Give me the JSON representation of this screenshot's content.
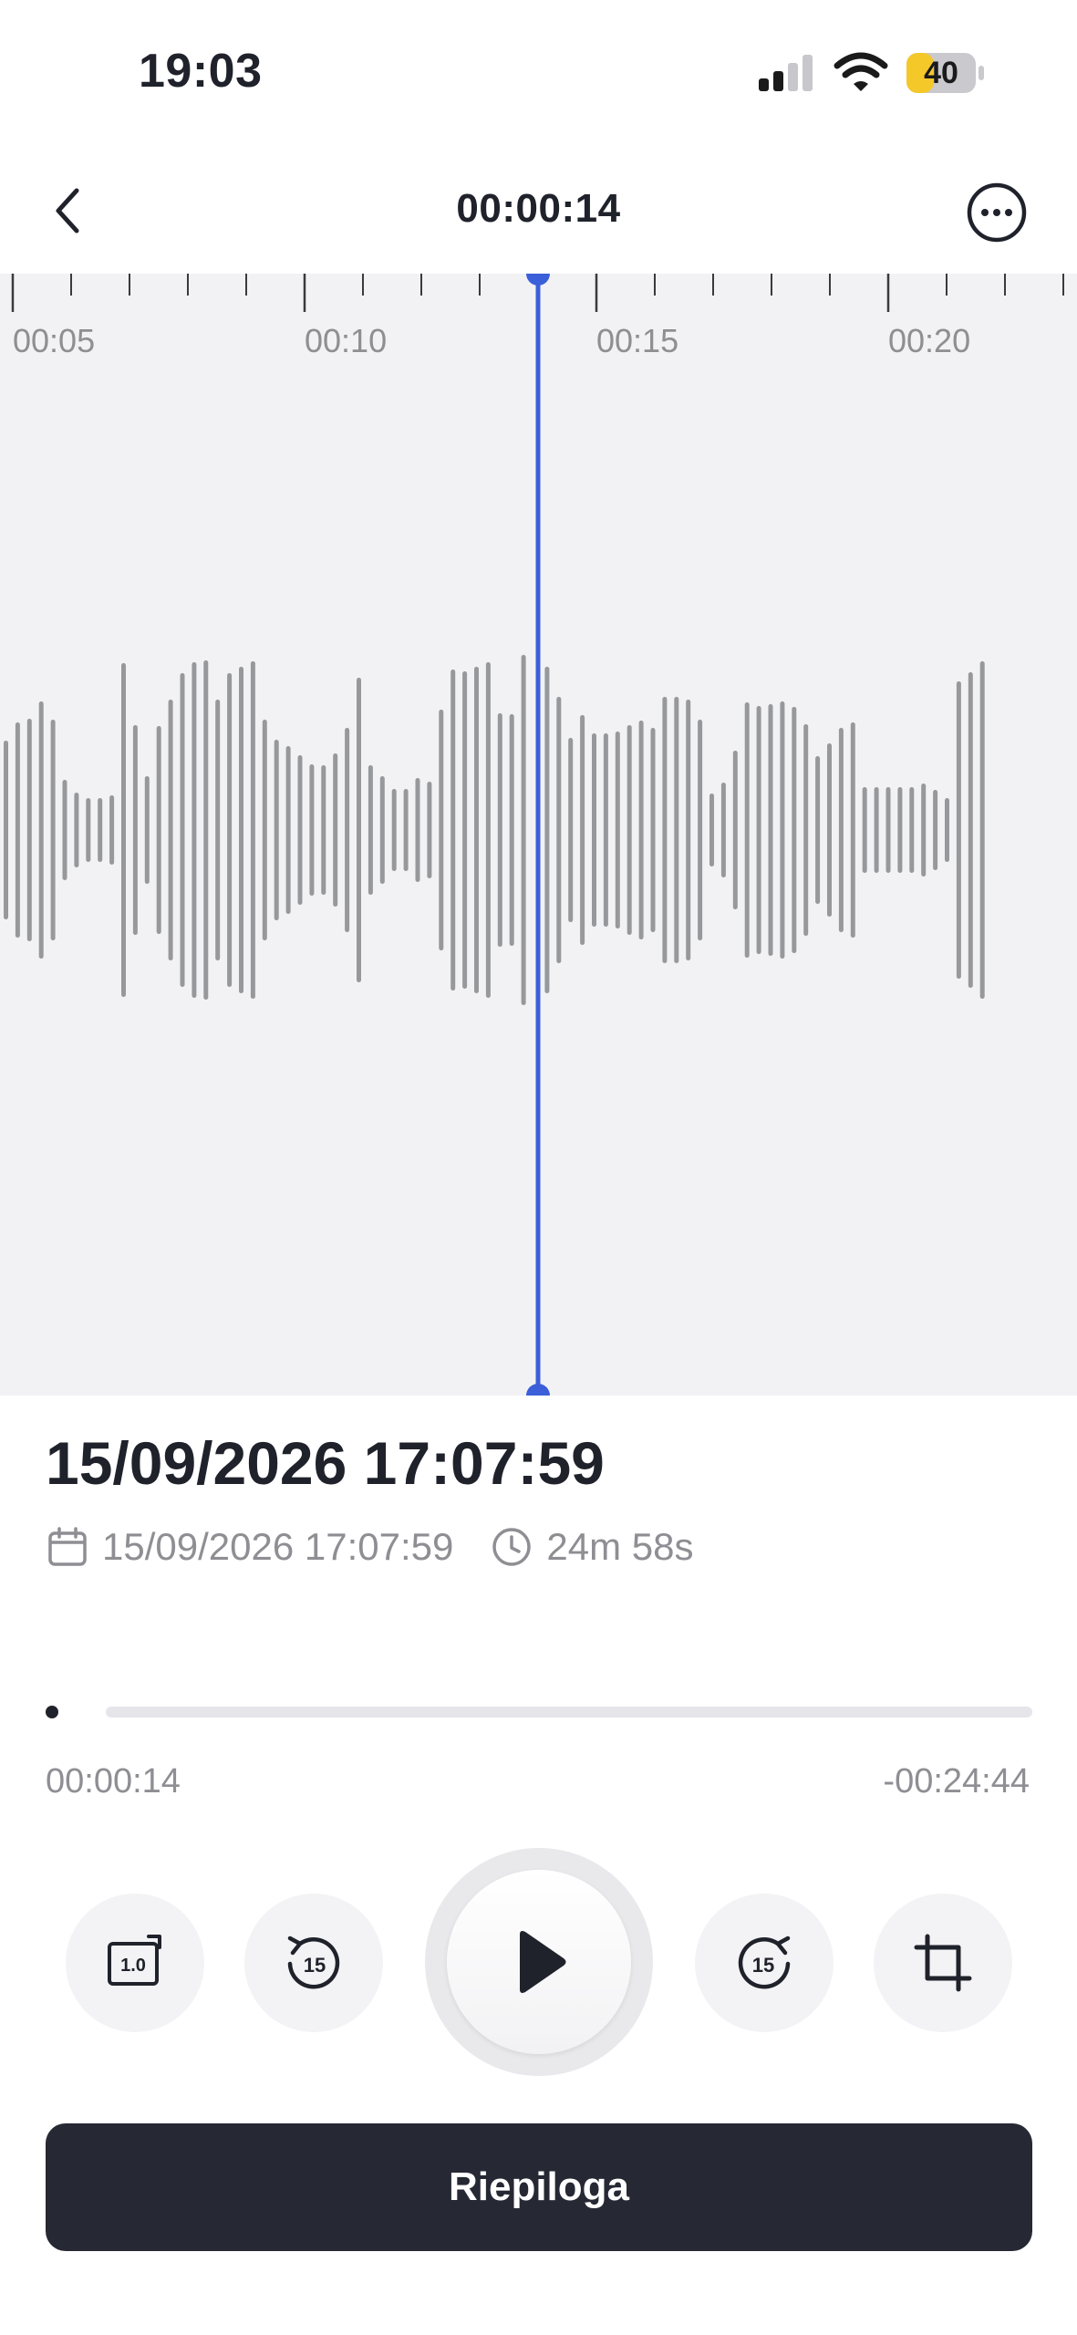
{
  "status_bar": {
    "time": "19:03",
    "battery_percent": "40",
    "battery_level": 0.4,
    "battery_color": "#f5c82a",
    "icons": [
      "signal-icon",
      "wifi-icon",
      "battery-icon"
    ]
  },
  "nav": {
    "back_icon": "chevron-left-icon",
    "title": "00:00:14",
    "more_icon": "ellipsis-circle-icon"
  },
  "waveform": {
    "timeline_labels": [
      "00:05",
      "00:10",
      "00:15",
      "00:20"
    ],
    "playhead_color": "#3b5fd9",
    "bar_color": "#97989c"
  },
  "recording": {
    "title": "15/09/2026 17:07:59",
    "date": "15/09/2026 17:07:59",
    "duration": "24m 58s",
    "date_icon": "calendar-icon",
    "duration_icon": "clock-icon"
  },
  "playback": {
    "current_time": "00:00:14",
    "remaining_time": "-00:24:44",
    "progress_fraction": 0.009,
    "controls": {
      "speed_label": "1.0",
      "rewind_label": "15",
      "forward_label": "15",
      "icons": [
        "speed-icon",
        "rewind-15-icon",
        "play-icon",
        "forward-15-icon",
        "crop-icon"
      ]
    }
  },
  "summarize_button": {
    "label": "Riepiloga"
  }
}
